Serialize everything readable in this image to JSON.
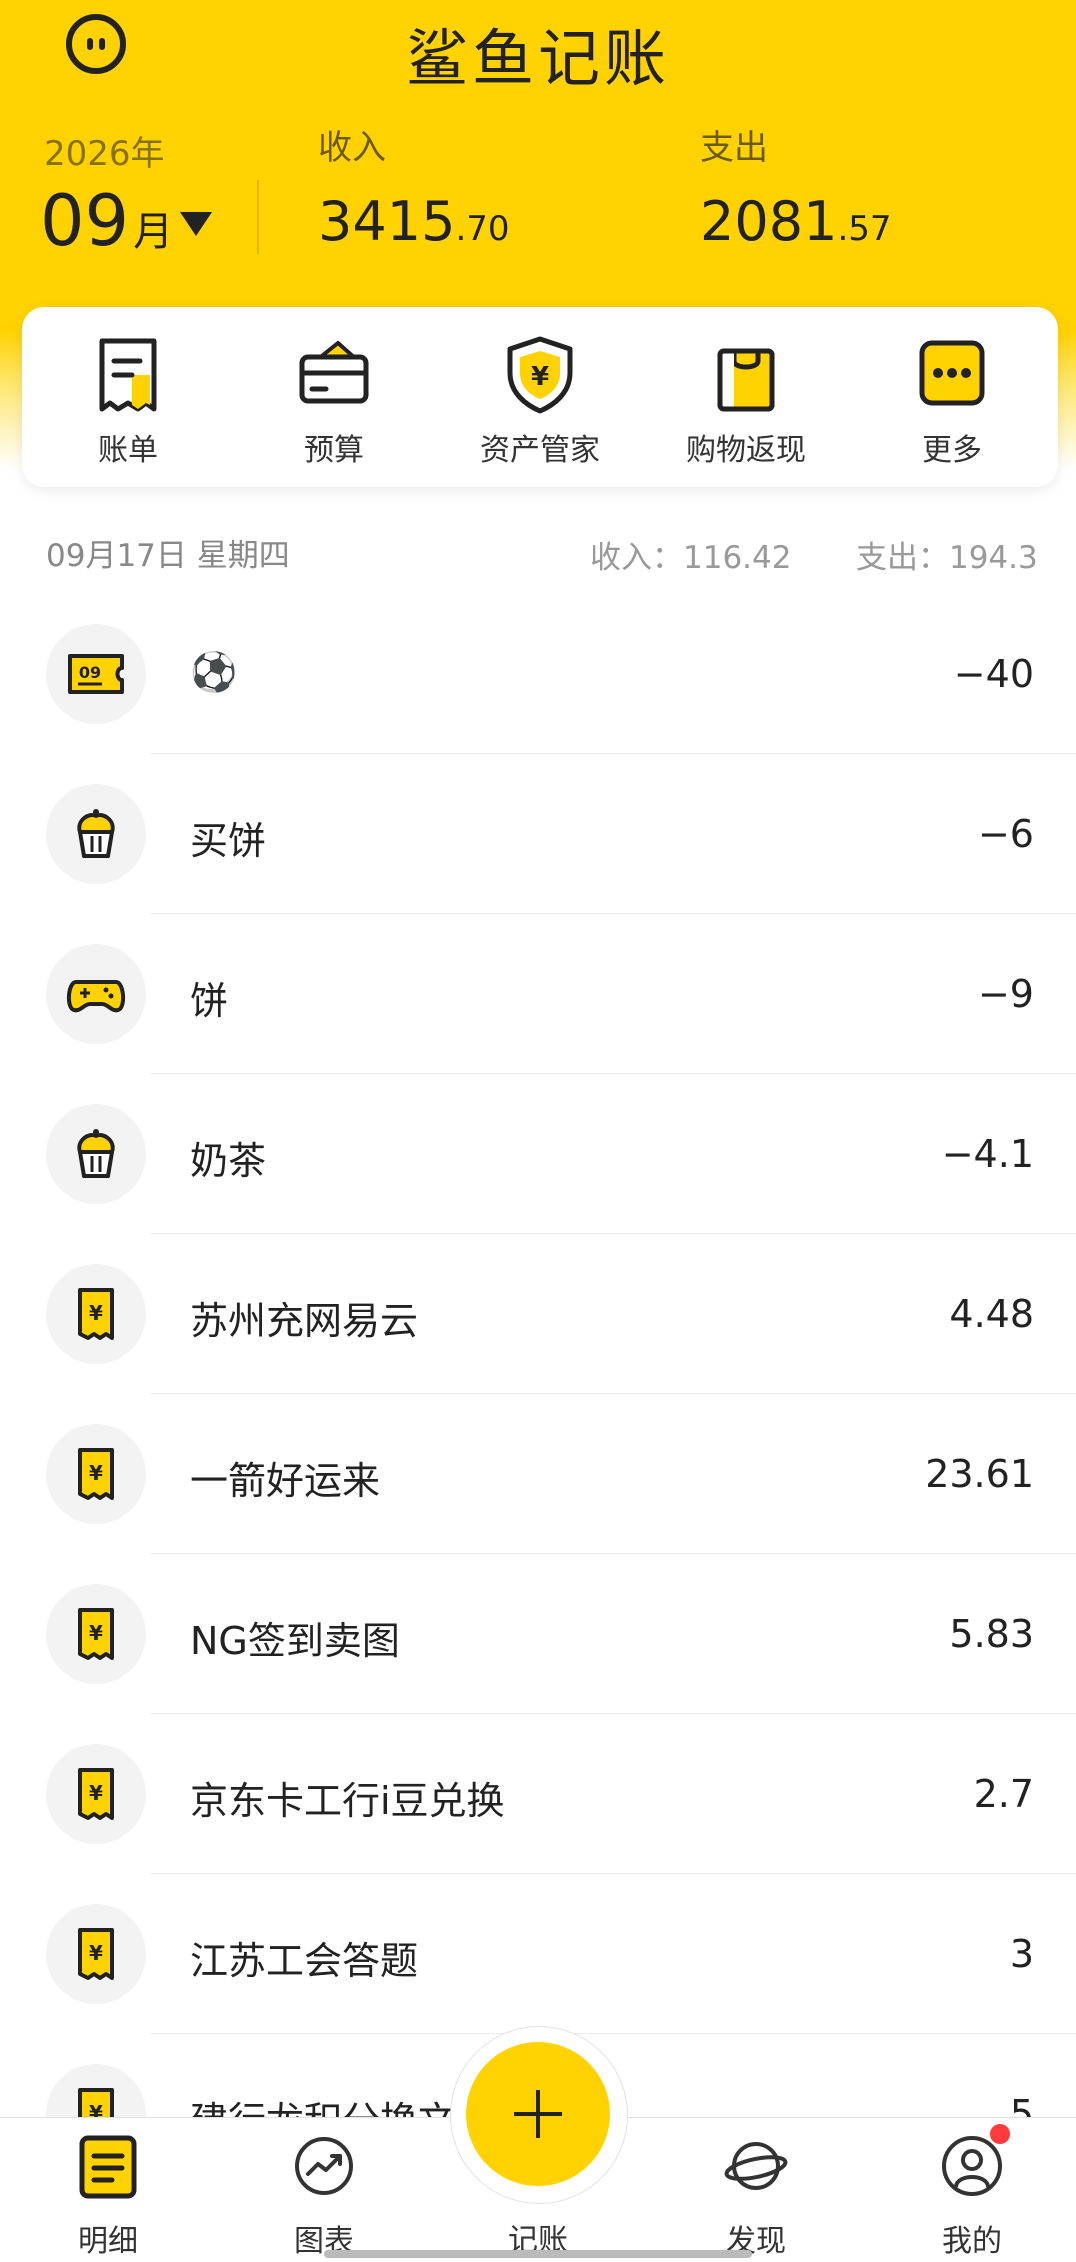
{
  "app": {
    "title": "鲨鱼记账"
  },
  "header": {
    "year": "2026年",
    "month": "09",
    "month_unit": "月",
    "income_label": "收入",
    "income_int": "3415",
    "income_dec": ".70",
    "expense_label": "支出",
    "expense_int": "2081",
    "expense_dec": ".57"
  },
  "quick_actions": [
    {
      "label": "账单",
      "icon": "bill-icon"
    },
    {
      "label": "预算",
      "icon": "wallet-icon"
    },
    {
      "label": "资产管家",
      "icon": "asset-shield-icon"
    },
    {
      "label": "购物返现",
      "icon": "shopping-bag-icon"
    },
    {
      "label": "更多",
      "icon": "more-icon"
    }
  ],
  "day": {
    "date": "09月17日 星期四",
    "income": "收入：116.42",
    "expense": "支出：194.3"
  },
  "transactions": [
    {
      "title": "⚽",
      "amount": "−40",
      "icon": "ticket-icon"
    },
    {
      "title": "买饼",
      "amount": "−6",
      "icon": "cupcake-icon"
    },
    {
      "title": "饼",
      "amount": "−9",
      "icon": "gamepad-icon"
    },
    {
      "title": "奶茶",
      "amount": "−4.1",
      "icon": "cupcake-icon"
    },
    {
      "title": "苏州充网易云",
      "amount": "4.48",
      "icon": "receipt-icon"
    },
    {
      "title": "一箭好运来",
      "amount": "23.61",
      "icon": "receipt-icon"
    },
    {
      "title": "NG签到卖图",
      "amount": "5.83",
      "icon": "receipt-icon"
    },
    {
      "title": "京东卡工行i豆兑换",
      "amount": "2.7",
      "icon": "receipt-icon"
    },
    {
      "title": "江苏工会答题",
      "amount": "3",
      "icon": "receipt-icon"
    },
    {
      "title": "建行龙积分换文",
      "amount": "5",
      "icon": "receipt-icon"
    }
  ],
  "tabs": [
    {
      "label": "明细"
    },
    {
      "label": "图表"
    },
    {
      "label": "记账"
    },
    {
      "label": "发现"
    },
    {
      "label": "我的"
    }
  ],
  "colors": {
    "brand": "#ffd200",
    "text": "#222222",
    "badge": "#ff3b3b"
  }
}
